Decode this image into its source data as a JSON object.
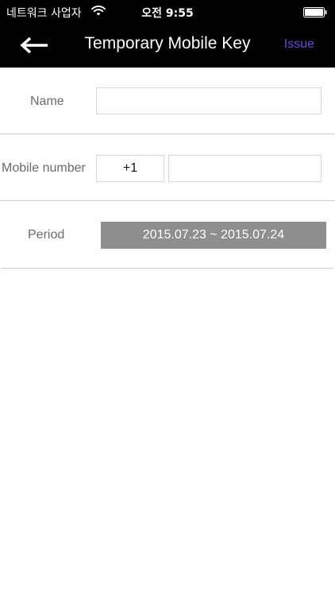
{
  "status_bar": {
    "carrier": "네트워크 사업자",
    "time": "오전 9:55",
    "wifi_icon": "wifi-icon",
    "battery_icon": "battery-icon"
  },
  "nav": {
    "back_icon": "arrow-left-icon",
    "title": "Temporary Mobile Key",
    "issue_label": "Issue",
    "issue_color": "#6a4bd6"
  },
  "form": {
    "name": {
      "label": "Name",
      "value": ""
    },
    "mobile": {
      "label": "Mobile number",
      "country_code": "+1",
      "value": ""
    },
    "period": {
      "label": "Period",
      "value": "2015.07.23 ~ 2015.07.24"
    }
  }
}
